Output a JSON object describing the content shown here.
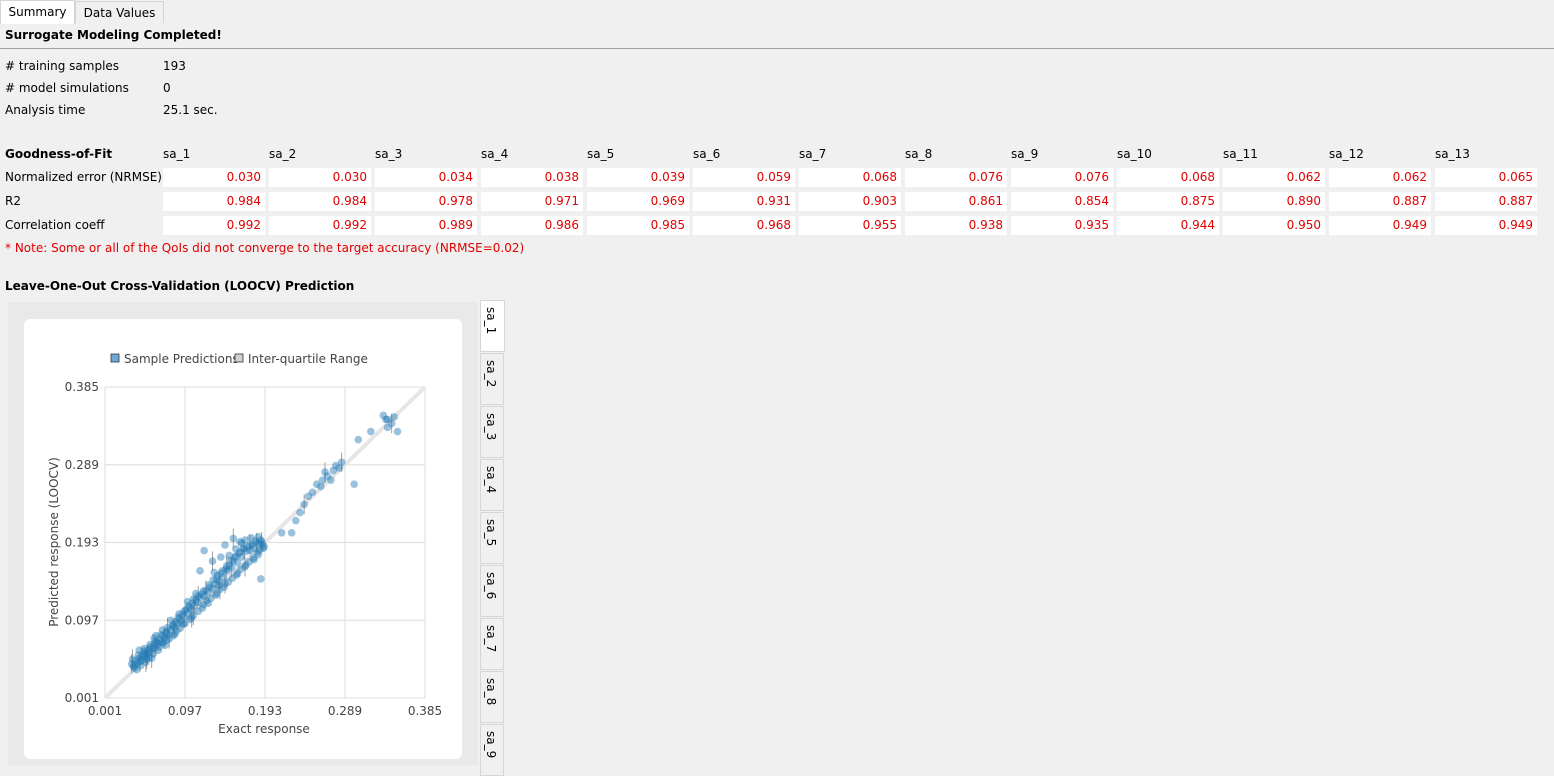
{
  "tabs": [
    "Summary",
    "Data Values"
  ],
  "status_title": "Surrogate Modeling Completed!",
  "stats": [
    {
      "label": "# training samples",
      "value": "193"
    },
    {
      "label": "# model simulations",
      "value": "0"
    },
    {
      "label": "Analysis time",
      "value": "25.1 sec."
    }
  ],
  "gof": {
    "title": "Goodness-of-Fit",
    "columns": [
      "sa_1",
      "sa_2",
      "sa_3",
      "sa_4",
      "sa_5",
      "sa_6",
      "sa_7",
      "sa_8",
      "sa_9",
      "sa_10",
      "sa_11",
      "sa_12",
      "sa_13"
    ],
    "rows": [
      {
        "label": "Normalized error (NRMSE)",
        "values": [
          "0.030",
          "0.030",
          "0.034",
          "0.038",
          "0.039",
          "0.059",
          "0.068",
          "0.076",
          "0.076",
          "0.068",
          "0.062",
          "0.062",
          "0.065"
        ]
      },
      {
        "label": "R2",
        "values": [
          "0.984",
          "0.984",
          "0.978",
          "0.971",
          "0.969",
          "0.931",
          "0.903",
          "0.861",
          "0.854",
          "0.875",
          "0.890",
          "0.887",
          "0.887"
        ]
      },
      {
        "label": "Correlation coeff",
        "values": [
          "0.992",
          "0.992",
          "0.989",
          "0.986",
          "0.985",
          "0.968",
          "0.955",
          "0.938",
          "0.935",
          "0.944",
          "0.950",
          "0.949",
          "0.949"
        ]
      }
    ],
    "note": "* Note: Some or all of the QoIs did not converge to the target accuracy (NRMSE=0.02)",
    "value_color": "#e00000"
  },
  "loocv": {
    "title": "Leave-One-Out Cross-Validation (LOOCV) Prediction",
    "side_tabs": [
      "sa_1",
      "sa_2",
      "sa_3",
      "sa_4",
      "sa_5",
      "sa_6",
      "sa_7",
      "sa_8",
      "sa_9"
    ],
    "active_tab": "sa_1"
  },
  "chart_data": {
    "type": "scatter",
    "xlabel": "Exact response",
    "ylabel": "Predicted response (LOOCV)",
    "xlim": [
      0.001,
      0.385
    ],
    "ylim": [
      0.001,
      0.385
    ],
    "xticks": [
      "0.001",
      "0.097",
      "0.193",
      "0.289",
      "0.385"
    ],
    "yticks": [
      "0.001",
      "0.097",
      "0.193",
      "0.289",
      "0.385"
    ],
    "grid": true,
    "legend_position": "top",
    "series": [
      {
        "name": "Sample Predictions",
        "color": "#1f77b4"
      },
      {
        "name": "Inter-quartile Range",
        "color": "#a0a0a0"
      }
    ],
    "points": [
      [
        0.033,
        0.043
      ],
      [
        0.035,
        0.04
      ],
      [
        0.037,
        0.042
      ],
      [
        0.038,
        0.047
      ],
      [
        0.04,
        0.044
      ],
      [
        0.042,
        0.05
      ],
      [
        0.043,
        0.046
      ],
      [
        0.045,
        0.052
      ],
      [
        0.046,
        0.048
      ],
      [
        0.047,
        0.055
      ],
      [
        0.049,
        0.053
      ],
      [
        0.05,
        0.057
      ],
      [
        0.052,
        0.055
      ],
      [
        0.053,
        0.061
      ],
      [
        0.055,
        0.058
      ],
      [
        0.056,
        0.064
      ],
      [
        0.058,
        0.062
      ],
      [
        0.06,
        0.067
      ],
      [
        0.061,
        0.063
      ],
      [
        0.063,
        0.07
      ],
      [
        0.065,
        0.068
      ],
      [
        0.067,
        0.073
      ],
      [
        0.068,
        0.07
      ],
      [
        0.07,
        0.078
      ],
      [
        0.072,
        0.075
      ],
      [
        0.074,
        0.081
      ],
      [
        0.075,
        0.083
      ],
      [
        0.077,
        0.079
      ],
      [
        0.08,
        0.086
      ],
      [
        0.082,
        0.09
      ],
      [
        0.084,
        0.088
      ],
      [
        0.086,
        0.095
      ],
      [
        0.088,
        0.093
      ],
      [
        0.09,
        0.099
      ],
      [
        0.092,
        0.096
      ],
      [
        0.094,
        0.104
      ],
      [
        0.096,
        0.101
      ],
      [
        0.098,
        0.11
      ],
      [
        0.1,
        0.106
      ],
      [
        0.102,
        0.113
      ],
      [
        0.104,
        0.11
      ],
      [
        0.106,
        0.118
      ],
      [
        0.108,
        0.115
      ],
      [
        0.11,
        0.122
      ],
      [
        0.112,
        0.119
      ],
      [
        0.115,
        0.125
      ],
      [
        0.117,
        0.129
      ],
      [
        0.12,
        0.127
      ],
      [
        0.122,
        0.134
      ],
      [
        0.125,
        0.132
      ],
      [
        0.127,
        0.138
      ],
      [
        0.13,
        0.136
      ],
      [
        0.133,
        0.142
      ],
      [
        0.135,
        0.148
      ],
      [
        0.138,
        0.145
      ],
      [
        0.14,
        0.155
      ],
      [
        0.143,
        0.15
      ],
      [
        0.146,
        0.16
      ],
      [
        0.148,
        0.158
      ],
      [
        0.15,
        0.165
      ],
      [
        0.153,
        0.162
      ],
      [
        0.155,
        0.17
      ],
      [
        0.158,
        0.176
      ],
      [
        0.16,
        0.168
      ],
      [
        0.162,
        0.18
      ],
      [
        0.165,
        0.175
      ],
      [
        0.168,
        0.185
      ],
      [
        0.17,
        0.182
      ],
      [
        0.173,
        0.188
      ],
      [
        0.175,
        0.183
      ],
      [
        0.178,
        0.19
      ],
      [
        0.18,
        0.186
      ],
      [
        0.183,
        0.193
      ],
      [
        0.185,
        0.2
      ],
      [
        0.188,
        0.196
      ],
      [
        0.19,
        0.191
      ],
      [
        0.115,
        0.158
      ],
      [
        0.12,
        0.183
      ],
      [
        0.13,
        0.17
      ],
      [
        0.132,
        0.156
      ],
      [
        0.137,
        0.14
      ],
      [
        0.14,
        0.175
      ],
      [
        0.145,
        0.19
      ],
      [
        0.15,
        0.177
      ],
      [
        0.155,
        0.198
      ],
      [
        0.188,
        0.148
      ],
      [
        0.213,
        0.205
      ],
      [
        0.225,
        0.205
      ],
      [
        0.23,
        0.22
      ],
      [
        0.235,
        0.23
      ],
      [
        0.24,
        0.24
      ],
      [
        0.245,
        0.25
      ],
      [
        0.25,
        0.255
      ],
      [
        0.255,
        0.265
      ],
      [
        0.26,
        0.262
      ],
      [
        0.262,
        0.27
      ],
      [
        0.265,
        0.28
      ],
      [
        0.268,
        0.275
      ],
      [
        0.272,
        0.27
      ],
      [
        0.275,
        0.282
      ],
      [
        0.278,
        0.288
      ],
      [
        0.282,
        0.285
      ],
      [
        0.285,
        0.292
      ],
      [
        0.3,
        0.265
      ],
      [
        0.305,
        0.32
      ],
      [
        0.32,
        0.33
      ],
      [
        0.335,
        0.35
      ],
      [
        0.34,
        0.345
      ],
      [
        0.345,
        0.34
      ],
      [
        0.34,
        0.335
      ],
      [
        0.348,
        0.348
      ],
      [
        0.352,
        0.33
      ],
      [
        0.338,
        0.345
      ],
      [
        0.042,
        0.06
      ],
      [
        0.05,
        0.045
      ],
      [
        0.06,
        0.075
      ],
      [
        0.065,
        0.06
      ],
      [
        0.075,
        0.072
      ],
      [
        0.085,
        0.08
      ],
      [
        0.095,
        0.092
      ],
      [
        0.105,
        0.1
      ],
      [
        0.1,
        0.12
      ],
      [
        0.09,
        0.105
      ],
      [
        0.08,
        0.097
      ],
      [
        0.07,
        0.085
      ],
      [
        0.062,
        0.078
      ],
      [
        0.057,
        0.05
      ],
      [
        0.048,
        0.062
      ],
      [
        0.11,
        0.13
      ],
      [
        0.118,
        0.112
      ],
      [
        0.125,
        0.118
      ],
      [
        0.135,
        0.13
      ],
      [
        0.145,
        0.142
      ],
      [
        0.16,
        0.155
      ],
      [
        0.17,
        0.165
      ],
      [
        0.185,
        0.178
      ],
      [
        0.192,
        0.188
      ],
      [
        0.18,
        0.172
      ],
      [
        0.175,
        0.19
      ],
      [
        0.165,
        0.192
      ],
      [
        0.158,
        0.185
      ],
      [
        0.036,
        0.038
      ],
      [
        0.039,
        0.036
      ],
      [
        0.044,
        0.041
      ],
      [
        0.051,
        0.049
      ],
      [
        0.054,
        0.051
      ],
      [
        0.059,
        0.056
      ],
      [
        0.066,
        0.064
      ],
      [
        0.071,
        0.069
      ],
      [
        0.073,
        0.066
      ],
      [
        0.078,
        0.074
      ],
      [
        0.083,
        0.078
      ],
      [
        0.087,
        0.084
      ],
      [
        0.091,
        0.087
      ],
      [
        0.097,
        0.093
      ],
      [
        0.103,
        0.098
      ],
      [
        0.107,
        0.103
      ],
      [
        0.113,
        0.108
      ],
      [
        0.119,
        0.116
      ],
      [
        0.123,
        0.121
      ],
      [
        0.128,
        0.124
      ],
      [
        0.134,
        0.128
      ],
      [
        0.139,
        0.135
      ],
      [
        0.144,
        0.138
      ],
      [
        0.149,
        0.144
      ],
      [
        0.154,
        0.149
      ],
      [
        0.159,
        0.153
      ],
      [
        0.164,
        0.16
      ],
      [
        0.169,
        0.163
      ],
      [
        0.174,
        0.169
      ],
      [
        0.179,
        0.174
      ],
      [
        0.184,
        0.181
      ],
      [
        0.187,
        0.184
      ],
      [
        0.191,
        0.186
      ],
      [
        0.189,
        0.194
      ],
      [
        0.186,
        0.191
      ],
      [
        0.181,
        0.195
      ],
      [
        0.176,
        0.199
      ],
      [
        0.169,
        0.196
      ],
      [
        0.163,
        0.194
      ],
      [
        0.034,
        0.049
      ],
      [
        0.041,
        0.054
      ],
      [
        0.048,
        0.059
      ],
      [
        0.055,
        0.067
      ],
      [
        0.061,
        0.071
      ],
      [
        0.068,
        0.079
      ],
      [
        0.076,
        0.088
      ],
      [
        0.083,
        0.092
      ],
      [
        0.089,
        0.101
      ],
      [
        0.096,
        0.108
      ],
      [
        0.101,
        0.115
      ],
      [
        0.107,
        0.123
      ],
      [
        0.113,
        0.127
      ],
      [
        0.119,
        0.133
      ],
      [
        0.126,
        0.141
      ],
      [
        0.131,
        0.147
      ],
      [
        0.136,
        0.152
      ],
      [
        0.142,
        0.158
      ],
      [
        0.147,
        0.164
      ],
      [
        0.152,
        0.171
      ],
      [
        0.157,
        0.175
      ],
      [
        0.163,
        0.181
      ],
      [
        0.167,
        0.186
      ]
    ]
  }
}
